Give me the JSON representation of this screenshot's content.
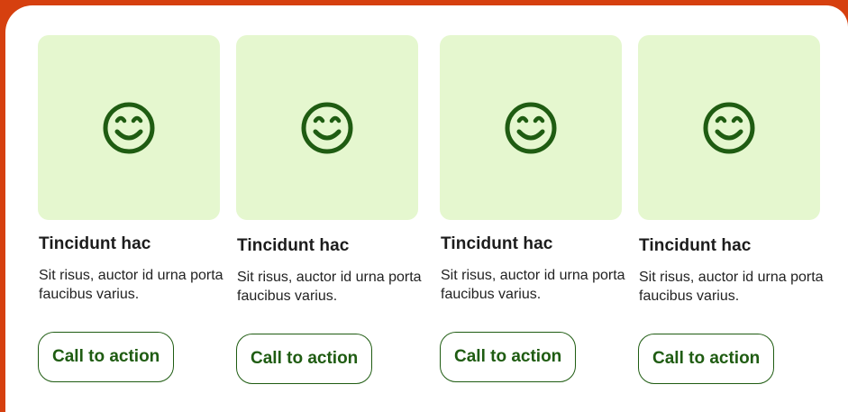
{
  "colors": {
    "outer_background": "#d6400f",
    "panel_background": "#ffffff",
    "tile_background": "#e5f7cf",
    "accent_green": "#1f5c12"
  },
  "cards": [
    {
      "icon": "smiley-face-icon",
      "title": "Tincidunt hac",
      "description": "Sit risus, auctor id urna porta faucibus varius.",
      "cta_label": "Call to action"
    },
    {
      "icon": "smiley-face-icon",
      "title": "Tincidunt hac",
      "description": "Sit risus, auctor id urna porta faucibus varius.",
      "cta_label": "Call to action"
    },
    {
      "icon": "smiley-face-icon",
      "title": "Tincidunt hac",
      "description": "Sit risus, auctor id urna porta faucibus varius.",
      "cta_label": "Call to action"
    },
    {
      "icon": "smiley-face-icon",
      "title": "Tincidunt hac",
      "description": "Sit risus, auctor id urna porta faucibus varius.",
      "cta_label": "Call to action"
    }
  ]
}
